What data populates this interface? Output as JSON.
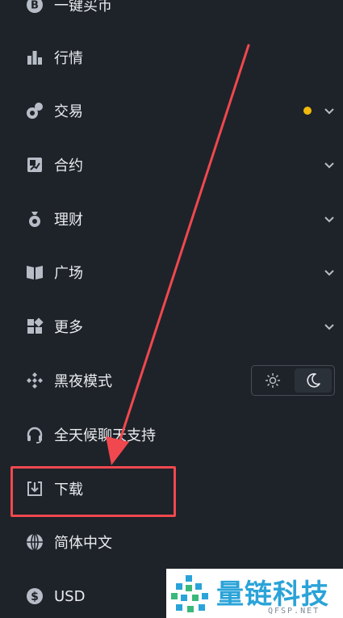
{
  "menu": {
    "items": [
      {
        "label": "一键买币",
        "icon": "bitcoin-coin-icon",
        "has_chevron": false
      },
      {
        "label": "行情",
        "icon": "bar-chart-icon",
        "has_chevron": false
      },
      {
        "label": "交易",
        "icon": "trade-circles-icon",
        "has_chevron": true,
        "has_dot": true
      },
      {
        "label": "合约",
        "icon": "futures-icon",
        "has_chevron": true
      },
      {
        "label": "理财",
        "icon": "money-bag-icon",
        "has_chevron": true
      },
      {
        "label": "广场",
        "icon": "open-book-icon",
        "has_chevron": true
      },
      {
        "label": "更多",
        "icon": "grid-icon",
        "has_chevron": true
      },
      {
        "label": "黑夜模式",
        "icon": "diamond-logo-icon",
        "has_theme_toggle": true
      },
      {
        "label": "全天候聊天支持",
        "icon": "headset-icon",
        "has_chevron": false
      },
      {
        "label": "下载",
        "icon": "download-icon",
        "has_chevron": false
      },
      {
        "label": "简体中文",
        "icon": "globe-icon",
        "has_chevron": false
      },
      {
        "label": "USD",
        "icon": "dollar-coin-icon",
        "has_chevron": false
      }
    ]
  },
  "theme_toggle": {
    "options": [
      "light",
      "dark"
    ],
    "selected": "dark"
  },
  "colors": {
    "background": "#1e2329",
    "text": "#eaecef",
    "icon": "#b7bdc6",
    "notification_dot": "#f0b90b",
    "annotation_red": "#f0484e",
    "watermark_blue": "#2aa3d8"
  },
  "watermark": {
    "name": "量链科技",
    "site": "QFSP.NET"
  }
}
